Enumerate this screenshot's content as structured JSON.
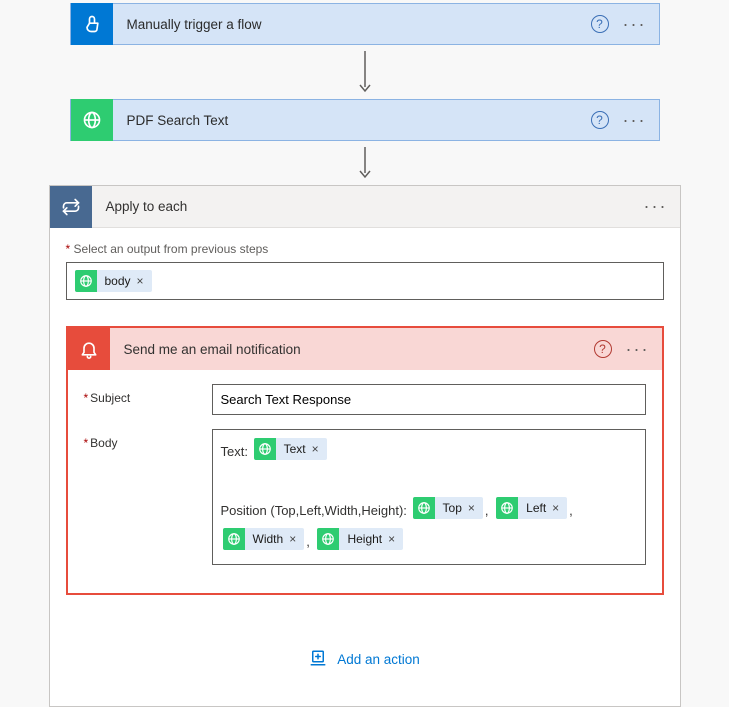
{
  "steps": {
    "trigger": {
      "title": "Manually trigger a flow"
    },
    "pdf": {
      "title": "PDF Search Text"
    }
  },
  "apply": {
    "title": "Apply to each",
    "select_label": "Select an output from previous steps",
    "select_token": "body"
  },
  "email": {
    "title": "Send me an email notification",
    "subject_label": "Subject",
    "subject_value": "Search Text Response",
    "body_label": "Body",
    "body": {
      "text_prefix": "Text: ",
      "text_token": "Text",
      "position_prefix": "Position (Top,Left,Width,Height): ",
      "top_token": "Top",
      "left_token": "Left",
      "width_token": "Width",
      "height_token": "Height"
    }
  },
  "add_action_label": "Add an action",
  "glyphs": {
    "help": "?",
    "dots": "···",
    "close": "×"
  }
}
